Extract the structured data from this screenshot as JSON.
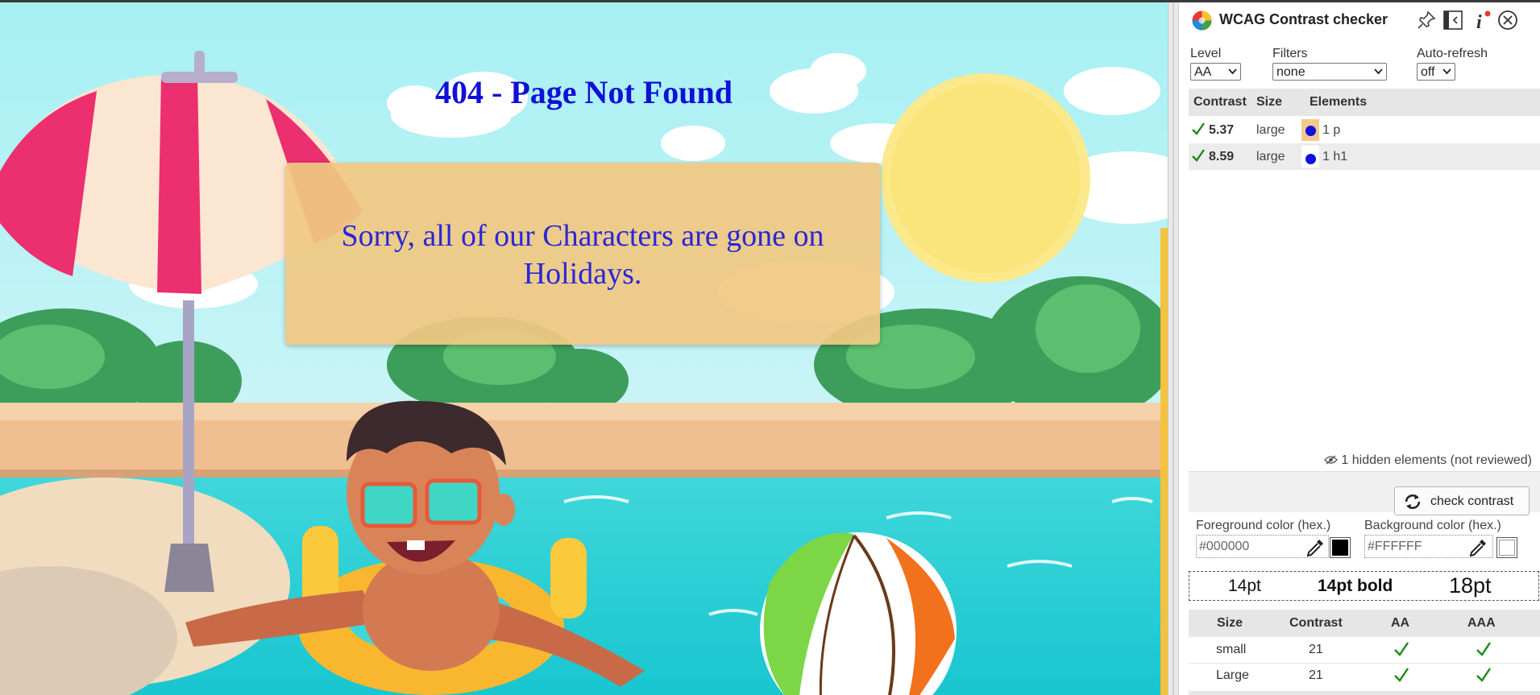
{
  "page": {
    "title": "404 - Page Not Found",
    "message_lines": [
      "Sorry, all of our Characters are gone on",
      "Holidays."
    ]
  },
  "panel": {
    "title": "WCAG Contrast checker",
    "header_icons": [
      "pin-icon",
      "dock-side-icon",
      "info-icon",
      "close-icon"
    ],
    "controls": {
      "level": {
        "label": "Level",
        "value": "AA"
      },
      "filters": {
        "label": "Filters",
        "value": "none"
      },
      "auto_refresh": {
        "label": "Auto-refresh",
        "value": "off"
      }
    },
    "results": {
      "columns": [
        "Contrast",
        "Size",
        "Elements"
      ],
      "rows": [
        {
          "ratio": "5.37",
          "size": "large",
          "elements": "1 p",
          "selected": true
        },
        {
          "ratio": "8.59",
          "size": "large",
          "elements": "1 h1",
          "selected": false
        }
      ]
    },
    "hidden_note": "1 hidden elements (not reviewed)",
    "check_button": "check contrast",
    "foreground": {
      "label": "Foreground color (hex.)",
      "value": "#000000",
      "swatch": "#000000"
    },
    "background": {
      "label": "Background color (hex.)",
      "value": "#FFFFFF",
      "swatch": "#FFFFFF"
    },
    "samples": {
      "normal": "14pt",
      "bold": "14pt bold",
      "large": "18pt"
    },
    "size_table": {
      "columns": [
        "Size",
        "Contrast",
        "AA",
        "AAA"
      ],
      "rows": [
        {
          "size": "small",
          "contrast": "21",
          "aa": true,
          "aaa": true
        },
        {
          "size": "Large",
          "contrast": "21",
          "aa": true,
          "aaa": true
        }
      ]
    }
  },
  "colors": {
    "heading_blue": "#1010d6",
    "pass_green": "#1a8a1a",
    "dot_blue": "#1010e0",
    "selected_cell": "#f3c98b"
  }
}
